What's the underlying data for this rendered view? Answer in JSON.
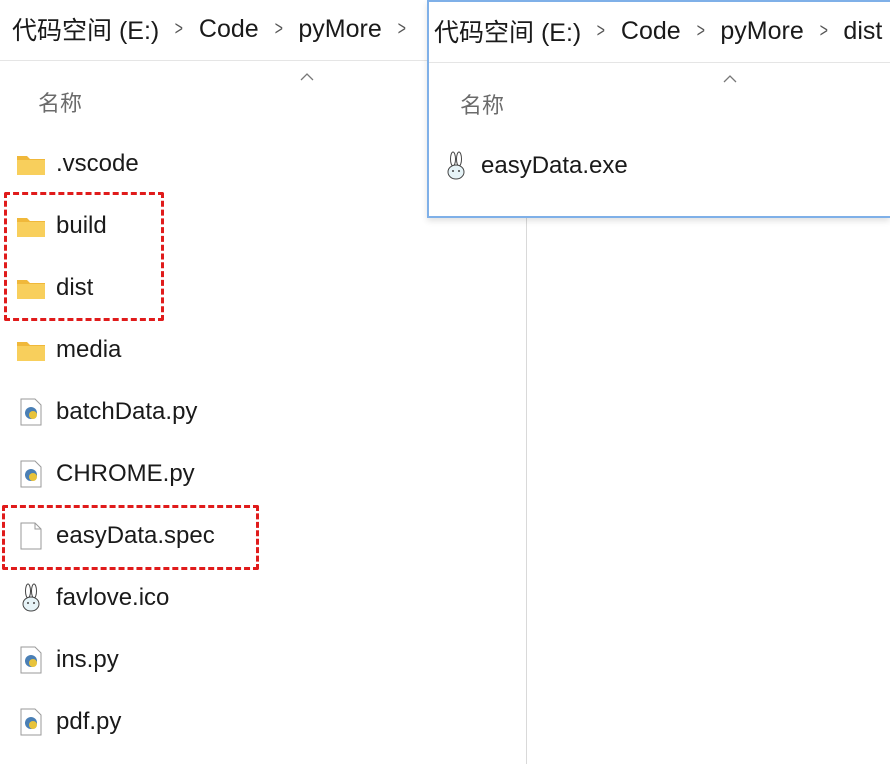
{
  "left_window": {
    "breadcrumb": [
      "代码空间 (E:)",
      "Code",
      "pyMore"
    ],
    "column_header": "名称",
    "items": [
      {
        "label": ".vscode",
        "icon": "folder-icon"
      },
      {
        "label": "build",
        "icon": "folder-icon"
      },
      {
        "label": "dist",
        "icon": "folder-icon"
      },
      {
        "label": "media",
        "icon": "folder-icon"
      },
      {
        "label": "batchData.py",
        "icon": "python-file-icon"
      },
      {
        "label": "CHROME.py",
        "icon": "python-file-icon"
      },
      {
        "label": "easyData.spec",
        "icon": "blank-file-icon"
      },
      {
        "label": "favlove.ico",
        "icon": "bunny-icon"
      },
      {
        "label": "ins.py",
        "icon": "python-file-icon"
      },
      {
        "label": "pdf.py",
        "icon": "python-file-icon"
      }
    ]
  },
  "right_window": {
    "breadcrumb": [
      "代码空间 (E:)",
      "Code",
      "pyMore",
      "dist"
    ],
    "column_header": "名称",
    "items": [
      {
        "label": "easyData.exe",
        "icon": "bunny-icon"
      }
    ]
  },
  "colors": {
    "highlight": "#e01b1b",
    "folder": "#f4c542",
    "python_blue": "#4a7fb5",
    "window_border": "#7fb0e8"
  },
  "highlighted_items": [
    "build",
    "dist",
    "easyData.spec"
  ]
}
